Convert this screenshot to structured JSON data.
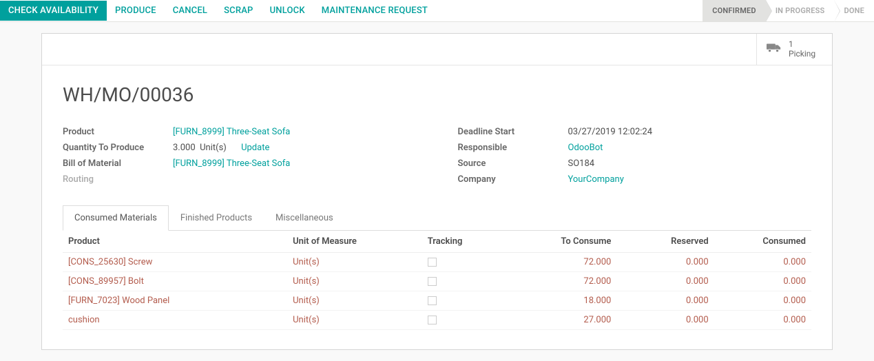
{
  "toolbar": {
    "check_availability": "CHECK AVAILABILITY",
    "produce": "PRODUCE",
    "cancel": "CANCEL",
    "scrap": "SCRAP",
    "unlock": "UNLOCK",
    "maintenance_request": "MAINTENANCE REQUEST"
  },
  "status": {
    "confirmed": "CONFIRMED",
    "in_progress": "IN PROGRESS",
    "done": "DONE"
  },
  "stat": {
    "count": "1",
    "label": "Picking"
  },
  "title": "WH/MO/00036",
  "left_fields": {
    "product_label": "Product",
    "product_value": "[FURN_8999] Three-Seat Sofa",
    "qty_label": "Quantity To Produce",
    "qty_value": "3.000",
    "qty_uom": "Unit(s)",
    "update": "Update",
    "bom_label": "Bill of Material",
    "bom_value": "[FURN_8999] Three-Seat Sofa",
    "routing_label": "Routing"
  },
  "right_fields": {
    "deadline_label": "Deadline Start",
    "deadline_value": "03/27/2019 12:02:24",
    "responsible_label": "Responsible",
    "responsible_value": "OdooBot",
    "source_label": "Source",
    "source_value": "SO184",
    "company_label": "Company",
    "company_value": "YourCompany"
  },
  "tabs": {
    "consumed": "Consumed Materials",
    "finished": "Finished Products",
    "misc": "Miscellaneous"
  },
  "table": {
    "headers": {
      "product": "Product",
      "uom": "Unit of Measure",
      "tracking": "Tracking",
      "to_consume": "To Consume",
      "reserved": "Reserved",
      "consumed": "Consumed"
    },
    "rows": [
      {
        "product": "[CONS_25630] Screw",
        "uom": "Unit(s)",
        "to_consume": "72.000",
        "reserved": "0.000",
        "consumed": "0.000"
      },
      {
        "product": "[CONS_89957] Bolt",
        "uom": "Unit(s)",
        "to_consume": "72.000",
        "reserved": "0.000",
        "consumed": "0.000"
      },
      {
        "product": "[FURN_7023] Wood Panel",
        "uom": "Unit(s)",
        "to_consume": "18.000",
        "reserved": "0.000",
        "consumed": "0.000"
      },
      {
        "product": "cushion",
        "uom": "Unit(s)",
        "to_consume": "27.000",
        "reserved": "0.000",
        "consumed": "0.000"
      }
    ]
  }
}
